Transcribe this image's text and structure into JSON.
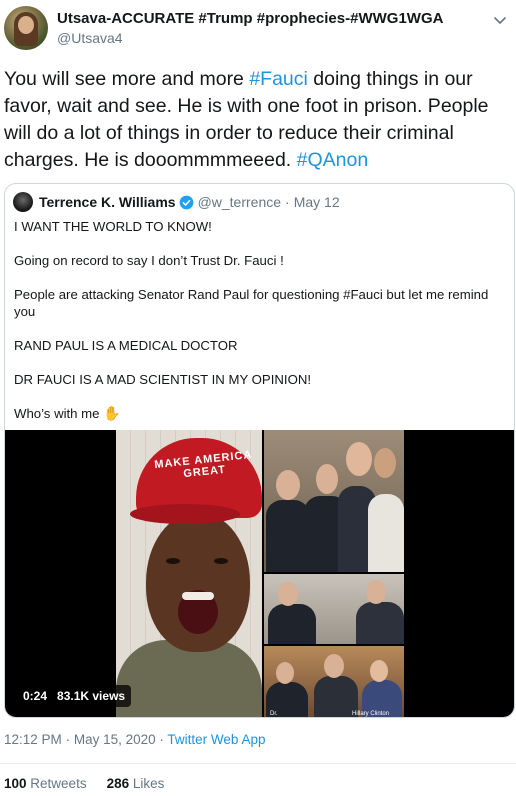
{
  "tweet": {
    "author": {
      "display_name": "Utsava-ACCURATE #Trump #prophecies-#WWG1WGA",
      "handle": "@Utsava4"
    },
    "text_segments": [
      {
        "text": "You will see more and more ",
        "type": "text"
      },
      {
        "text": "#Fauci",
        "type": "hashtag"
      },
      {
        "text": " doing things in our favor, wait and see. He is with one foot in prison. People will do a lot of things in order to reduce their criminal charges. He is dooommmmeeed. ",
        "type": "text"
      },
      {
        "text": "#QAnon",
        "type": "hashtag"
      }
    ],
    "time": "12:12 PM",
    "date": "May 15, 2020",
    "source": "Twitter Web App",
    "separator": "·",
    "retweets_count": "100",
    "retweets_label": "Retweets",
    "likes_count": "286",
    "likes_label": "Likes"
  },
  "quoted_tweet": {
    "name": "Terrence K. Williams",
    "handle": "@w_terrence",
    "separator": "·",
    "date": "May 12",
    "paragraphs": [
      "I WANT THE WORLD TO KNOW!",
      "Going on record to say I don’t Trust Dr. Fauci !",
      "People are attacking Senator Rand Paul for questioning #Fauci but let me remind you",
      "RAND PAUL IS A MEDICAL DOCTOR",
      "DR FAUCI IS A MAD SCIENTIST IN MY OPINION!"
    ],
    "last_line": "Who’s with me",
    "wave_emoji": "✋",
    "video": {
      "duration": "0:24",
      "views": "83.1K views",
      "hat_text": "MAKE AMERICA GREAT",
      "caption_1": "Dr.",
      "caption_2": "Hillary Clinton"
    }
  },
  "colors": {
    "link": "#1b95e0",
    "secondary_text": "#657786",
    "primary_text": "#14171a",
    "border": "#ccd6dd",
    "verified": "#1da1f2"
  }
}
